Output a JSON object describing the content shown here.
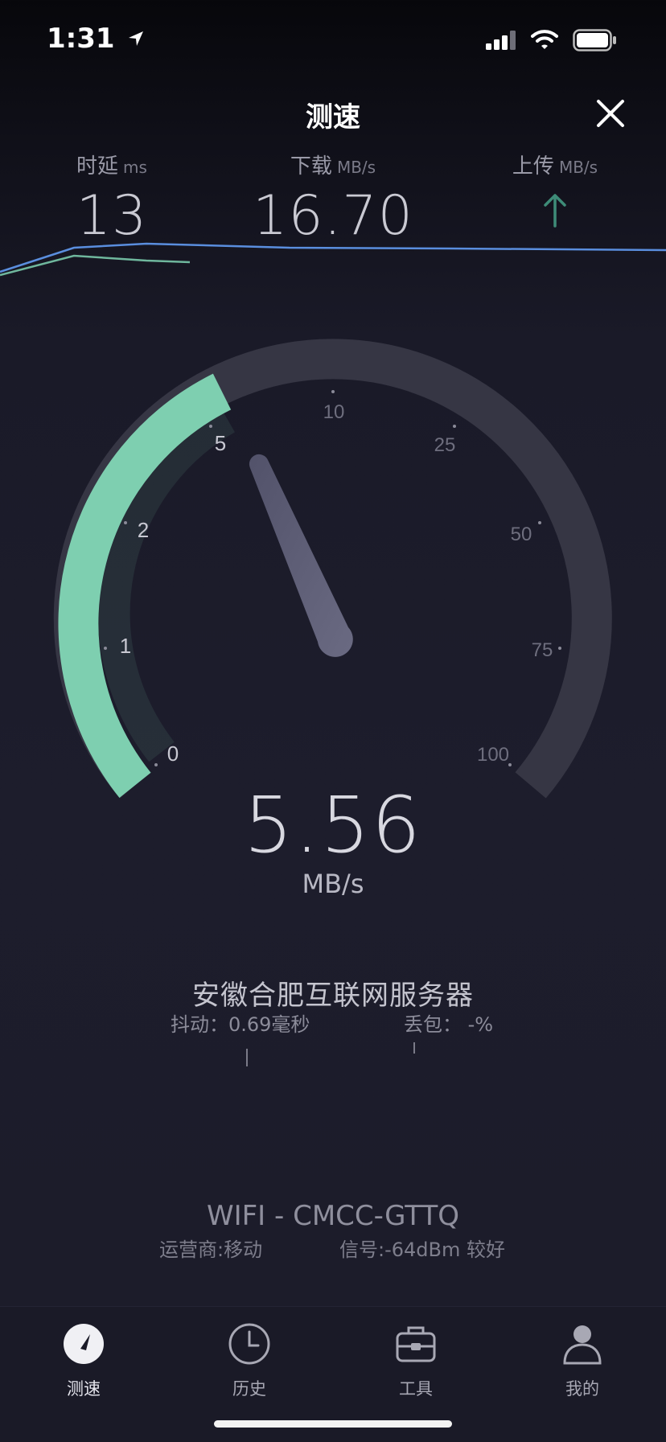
{
  "status_bar": {
    "time": "1:31"
  },
  "header": {
    "title": "测速"
  },
  "metrics": {
    "latency": {
      "label": "时延",
      "unit": "ms",
      "value": "13"
    },
    "download": {
      "label": "下载",
      "unit": "MB/s",
      "value": "16.70"
    },
    "upload": {
      "label": "上传",
      "unit": "MB/s",
      "value": ""
    }
  },
  "gauge": {
    "ticks": [
      "0",
      "1",
      "2",
      "5",
      "10",
      "25",
      "50",
      "75",
      "100"
    ],
    "current_speed": "5.56",
    "unit": "MB/s",
    "accent_color": "#7ecfb0",
    "track_color": "#363644"
  },
  "server": {
    "name": "安徽合肥互联网服务器",
    "jitter": "抖动：0.69毫秒",
    "packet_loss": "丢包： -%"
  },
  "network": {
    "wifi": "WIFI - CMCC-GTTQ",
    "carrier": "运营商:移动",
    "signal": "信号:-64dBm 较好"
  },
  "tabs": [
    {
      "label": "测速",
      "icon": "speedometer-icon",
      "active": true
    },
    {
      "label": "历史",
      "icon": "clock-icon",
      "active": false
    },
    {
      "label": "工具",
      "icon": "toolbox-icon",
      "active": false
    },
    {
      "label": "我的",
      "icon": "user-icon",
      "active": false
    }
  ]
}
